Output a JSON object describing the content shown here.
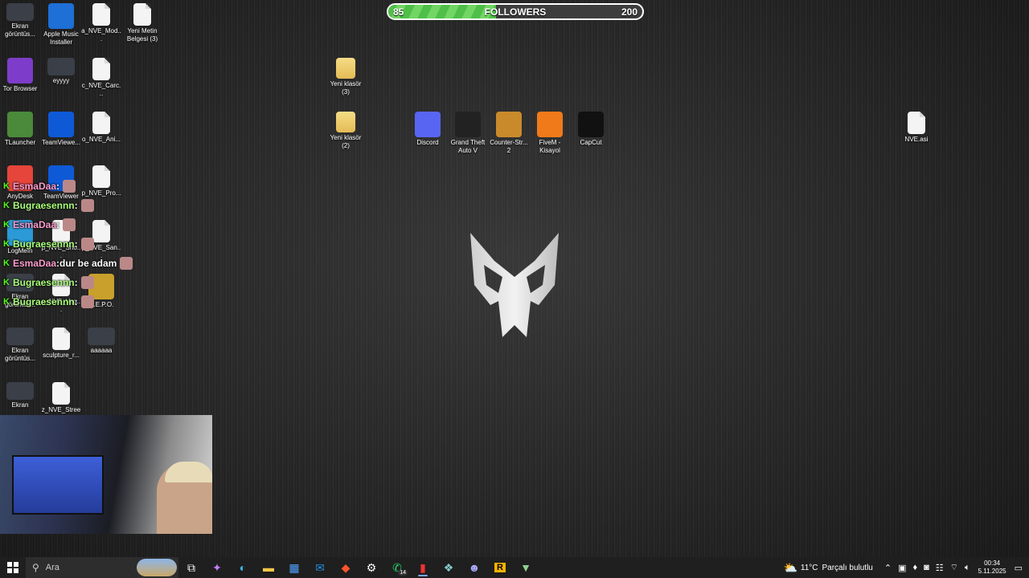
{
  "followers": {
    "current": "85",
    "label": "FOLLOWERS",
    "goal": "200",
    "progress": 0.425
  },
  "desktop_icons": [
    {
      "label": "Ekran görüntüs...",
      "kind": "thumb"
    },
    {
      "label": "Apple Music Installer",
      "kind": "app"
    },
    {
      "label": "a_NVE_Mod...",
      "kind": "file"
    },
    {
      "label": "Yeni Metin Belgesi (3)",
      "kind": "file"
    },
    {
      "label": "Tor Browser",
      "kind": "app"
    },
    {
      "label": "eyyyy",
      "kind": "thumb"
    },
    {
      "label": "c_NVE_Carc...",
      "kind": "file"
    },
    {
      "label": "Yeni klasör (3)",
      "kind": "folder"
    },
    {
      "label": "TLauncher",
      "kind": "app"
    },
    {
      "label": "TeamViewe...",
      "kind": "app"
    },
    {
      "label": "o_NVE_Ani...",
      "kind": "file"
    },
    {
      "label": "Yeni klasör (2)",
      "kind": "folder"
    },
    {
      "label": "Discord",
      "kind": "app"
    },
    {
      "label": "Grand Theft Auto V",
      "kind": "app"
    },
    {
      "label": "Counter-Str... 2",
      "kind": "app"
    },
    {
      "label": "FiveM - Kisayol",
      "kind": "app"
    },
    {
      "label": "CapCut",
      "kind": "app"
    },
    {
      "label": "NVE.asi",
      "kind": "file"
    },
    {
      "label": "AnyDesk",
      "kind": "app"
    },
    {
      "label": "TeamViewer",
      "kind": "app"
    },
    {
      "label": "p_NVE_Pro...",
      "kind": "file"
    },
    {
      "label": "LogMeIn",
      "kind": "app"
    },
    {
      "label": "p_NVE_Sno...",
      "kind": "file"
    },
    {
      "label": "p_NVE_San...",
      "kind": "file"
    },
    {
      "label": "Ekran görüntüs...",
      "kind": "thumb"
    },
    {
      "label": "p_NVE_Veg...",
      "kind": "file"
    },
    {
      "label": "R.E.P.O.",
      "kind": "app"
    },
    {
      "label": "Ekran görüntüs...",
      "kind": "thumb"
    },
    {
      "label": "sculpture_r...",
      "kind": "file"
    },
    {
      "label": "aaaaaa",
      "kind": "thumb"
    },
    {
      "label": "Ekran",
      "kind": "thumb"
    },
    {
      "label": "z_NVE_Stree...",
      "kind": "file"
    }
  ],
  "chat": [
    {
      "badge": "K",
      "user": "EsmaDaa",
      "sep": " :",
      "message": "",
      "color": "pink"
    },
    {
      "badge": "K",
      "user": "Bugraesennn",
      "sep": " :",
      "message": "",
      "color": "green"
    },
    {
      "badge": "K",
      "user": "EsmaDaa",
      "sep": " :",
      "message": "",
      "color": "pink"
    },
    {
      "badge": "K",
      "user": "Bugraesennn",
      "sep": " :",
      "message": "",
      "color": "green"
    },
    {
      "badge": "K",
      "user": "EsmaDaa",
      "sep": " :",
      "message": " dur be adam",
      "color": "pink"
    },
    {
      "badge": "K",
      "user": "Bugraesennn",
      "sep": " :",
      "message": "",
      "color": "green"
    },
    {
      "badge": "K",
      "user": "Bugraesennn",
      "sep": " :",
      "message": "",
      "color": "green"
    }
  ],
  "taskbar": {
    "search_placeholder": "Ara",
    "whatsapp_badge": "14",
    "weather_temp": "11°C",
    "weather_text": "Parçalı bulutlu",
    "time": "00:34",
    "date": "5.11.2025"
  }
}
